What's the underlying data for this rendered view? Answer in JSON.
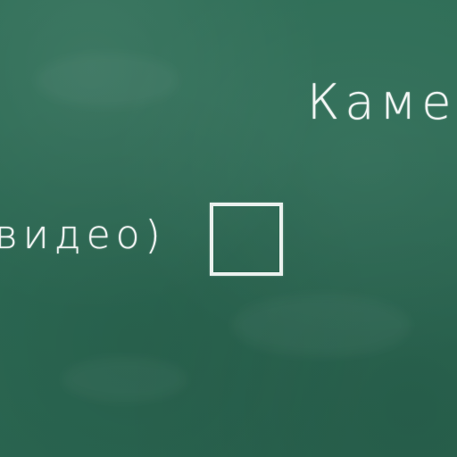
{
  "board": {
    "title": "Каме",
    "option_label": "видео)",
    "checkbox_checked": false
  },
  "colors": {
    "background": "#2c6a54",
    "chalk": "#f6f9f7"
  }
}
